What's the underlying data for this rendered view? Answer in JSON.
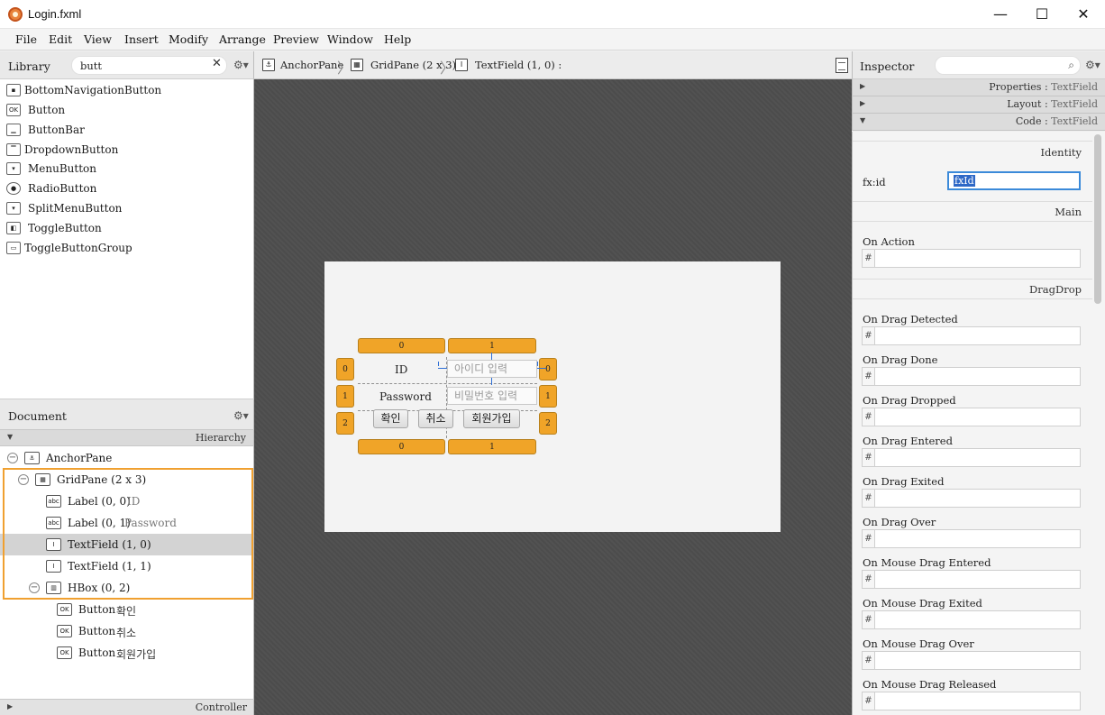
{
  "window": {
    "title": "Login.fxml",
    "minimize": "—",
    "maximize": "☐",
    "close": "✕"
  },
  "menu": [
    "File",
    "Edit",
    "View",
    "Insert",
    "Modify",
    "Arrange",
    "Preview",
    "Window",
    "Help"
  ],
  "library": {
    "title": "Library",
    "search_value": "butt",
    "items": [
      {
        "label": "BottomNavigationButton",
        "icon": "bottom-navigation-button-icon",
        "glyph": "▪"
      },
      {
        "label": "Button",
        "icon": "button-icon",
        "glyph": "OK"
      },
      {
        "label": "ButtonBar",
        "icon": "button-bar-icon",
        "glyph": "▁"
      },
      {
        "label": "DropdownButton",
        "icon": "dropdown-button-icon",
        "glyph": "▔"
      },
      {
        "label": "MenuButton",
        "icon": "menu-button-icon",
        "glyph": "▾"
      },
      {
        "label": "RadioButton",
        "icon": "radio-button-icon",
        "glyph": "●"
      },
      {
        "label": "SplitMenuButton",
        "icon": "split-menu-button-icon",
        "glyph": "▾"
      },
      {
        "label": "ToggleButton",
        "icon": "toggle-button-icon",
        "glyph": "◧"
      },
      {
        "label": "ToggleButtonGroup",
        "icon": "toggle-button-group-icon",
        "glyph": "▭"
      }
    ]
  },
  "document": {
    "title": "Document",
    "hierarchy_label": "Hierarchy",
    "controller_label": "Controller",
    "tree": [
      {
        "label": "AnchorPane",
        "sub": "",
        "depth": 0,
        "icon": "anchor-pane-icon",
        "glyph": "⚓",
        "toggle": "−"
      },
      {
        "label": "GridPane (2 x 3)",
        "sub": "",
        "depth": 1,
        "icon": "grid-pane-icon",
        "glyph": "▦",
        "toggle": "−"
      },
      {
        "label": "Label (0, 0)",
        "sub": "ID",
        "depth": 2,
        "icon": "label-icon",
        "glyph": "abc",
        "toggle": ""
      },
      {
        "label": "Label (0, 1)",
        "sub": "Password",
        "depth": 2,
        "icon": "label-icon",
        "glyph": "abc",
        "toggle": ""
      },
      {
        "label": "TextField (1, 0)",
        "sub": "",
        "depth": 2,
        "icon": "text-field-icon",
        "glyph": "I",
        "toggle": "",
        "selected": true
      },
      {
        "label": "TextField (1, 1)",
        "sub": "",
        "depth": 2,
        "icon": "text-field-icon",
        "glyph": "I",
        "toggle": ""
      },
      {
        "label": "HBox (0, 2)",
        "sub": "",
        "depth": 2,
        "icon": "hbox-icon",
        "glyph": "▥",
        "toggle": "−"
      },
      {
        "label": "Button",
        "sub": "확인",
        "depth": 3,
        "icon": "button-icon",
        "glyph": "OK",
        "toggle": ""
      },
      {
        "label": "Button",
        "sub": "취소",
        "depth": 3,
        "icon": "button-icon",
        "glyph": "OK",
        "toggle": ""
      },
      {
        "label": "Button",
        "sub": "회원가입",
        "depth": 3,
        "icon": "button-icon",
        "glyph": "OK",
        "toggle": ""
      }
    ]
  },
  "breadcrumb": [
    {
      "label": "AnchorPane",
      "icon": "anchor-pane-icon",
      "glyph": "⚓"
    },
    {
      "label": "GridPane (2 x 3)",
      "icon": "grid-pane-icon",
      "glyph": "▦"
    },
    {
      "label": "TextField (1, 0) :",
      "icon": "text-field-icon",
      "glyph": "I"
    }
  ],
  "canvas": {
    "col_handles": [
      "0",
      "1"
    ],
    "row_handles": [
      "0",
      "1",
      "2"
    ],
    "id_label": "ID",
    "password_label": "Password",
    "id_placeholder": "아이디 입력",
    "password_placeholder": "비밀번호 입력",
    "confirm_button": "확인",
    "cancel_button": "취소",
    "signup_button": "회원가입"
  },
  "inspector": {
    "title": "Inspector",
    "sections": [
      {
        "label": "Properties",
        "sub": "TextField",
        "arrow": "▶"
      },
      {
        "label": "Layout",
        "sub": "TextField",
        "arrow": "▶"
      },
      {
        "label": "Code",
        "sub": "TextField",
        "arrow": "▼"
      }
    ],
    "identity_group": "Identity",
    "fxid_label": "fx:id",
    "fxid_value": "fxId",
    "main_group": "Main",
    "on_action_label": "On Action",
    "dragdrop_group": "DragDrop",
    "hash": "#",
    "dragdrop_props": [
      "On Drag Detected",
      "On Drag Done",
      "On Drag Dropped",
      "On Drag Entered",
      "On Drag Exited",
      "On Drag Over",
      "On Mouse Drag Entered",
      "On Mouse Drag Exited",
      "On Mouse Drag Over",
      "On Mouse Drag Released"
    ]
  }
}
